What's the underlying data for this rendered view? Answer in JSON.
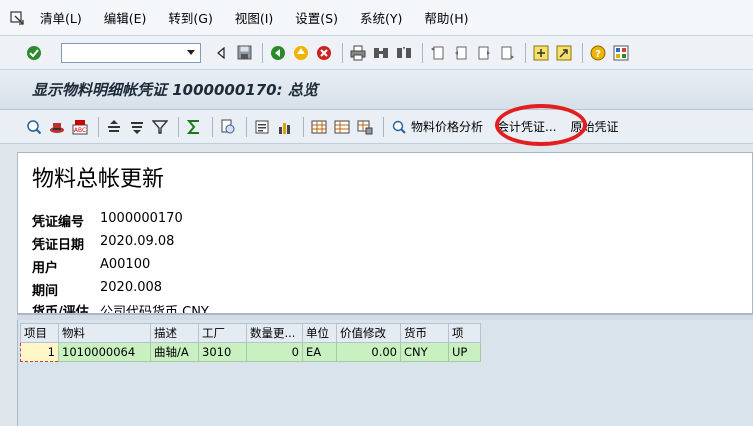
{
  "menu": {
    "items": [
      "清单(L)",
      "编辑(E)",
      "转到(G)",
      "视图(I)",
      "设置(S)",
      "系统(Y)",
      "帮助(H)"
    ]
  },
  "std_toolbar": {
    "command_value": "",
    "icons": [
      "enter-icon",
      "save-icon",
      "back-icon",
      "exit-icon",
      "cancel-icon",
      "print-icon",
      "find-icon",
      "find-next-icon",
      "first-page-icon",
      "prev-page-icon",
      "next-page-icon",
      "last-page-icon",
      "new-session-icon",
      "shortcut-icon",
      "help-icon",
      "layout-icon"
    ]
  },
  "title": "显示物料明细帐凭证 1000000170: 总览",
  "app_toolbar": {
    "material_price_analysis": "物料价格分析",
    "accounting_docs": "会计凭证...",
    "original_doc": "原始凭证"
  },
  "header": {
    "heading": "物料总帐更新",
    "fields": [
      {
        "label": "凭证编号",
        "value": "1000000170"
      },
      {
        "label": "凭证日期",
        "value": "2020.09.08"
      },
      {
        "label": "用户",
        "value": "A00100"
      },
      {
        "label": "期间",
        "value": "2020.008"
      },
      {
        "label": "货币/评估",
        "value": "公司代码货币 CNY"
      }
    ]
  },
  "grid": {
    "columns": [
      "项目",
      "物料",
      "描述",
      "工厂",
      "数量更...",
      "单位",
      "价值修改",
      "货币",
      "项"
    ],
    "rows": [
      {
        "item": "1",
        "material": "1010000064",
        "desc": "曲轴/A",
        "plant": "3010",
        "qty": "0",
        "unit": "EA",
        "value": "0.00",
        "currency": "CNY",
        "type": "UP"
      }
    ]
  },
  "colors": {
    "highlight_ring": "#e21e1e",
    "row_bg": "#c9f0c0"
  }
}
